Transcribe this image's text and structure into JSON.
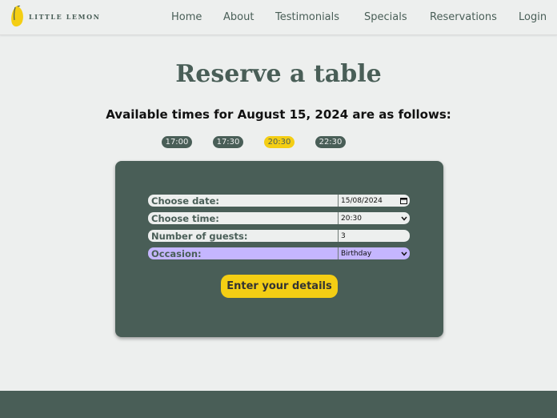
{
  "brand": {
    "name": "LITTLE LEMON",
    "colors": {
      "primary": "#495e57",
      "accent": "#f4ce14",
      "background": "#edefee",
      "highlight": "#c5b6ff"
    }
  },
  "nav": {
    "items": [
      {
        "label": "Home"
      },
      {
        "label": "About"
      },
      {
        "label": "Testimonials"
      },
      {
        "label": "Specials"
      },
      {
        "label": "Reservations"
      },
      {
        "label": "Login"
      }
    ]
  },
  "page": {
    "title": "Reserve a table",
    "subtitle": "Available times for August 15, 2024 are as follows:"
  },
  "times": {
    "slots": [
      "17:00",
      "17:30",
      "20:30",
      "22:30"
    ],
    "selected": "20:30"
  },
  "form": {
    "date": {
      "label": "Choose date:",
      "value": "15/08/2024",
      "icon": "calendar-icon"
    },
    "time": {
      "label": "Choose time:",
      "value": "20:30",
      "icon": "chevron-down-icon"
    },
    "guests": {
      "label": "Number of guests:",
      "value": "3"
    },
    "occasion": {
      "label": "Occasion:",
      "value": "Birthday",
      "icon": "chevron-down-icon"
    },
    "submit_label": "Enter your details"
  }
}
